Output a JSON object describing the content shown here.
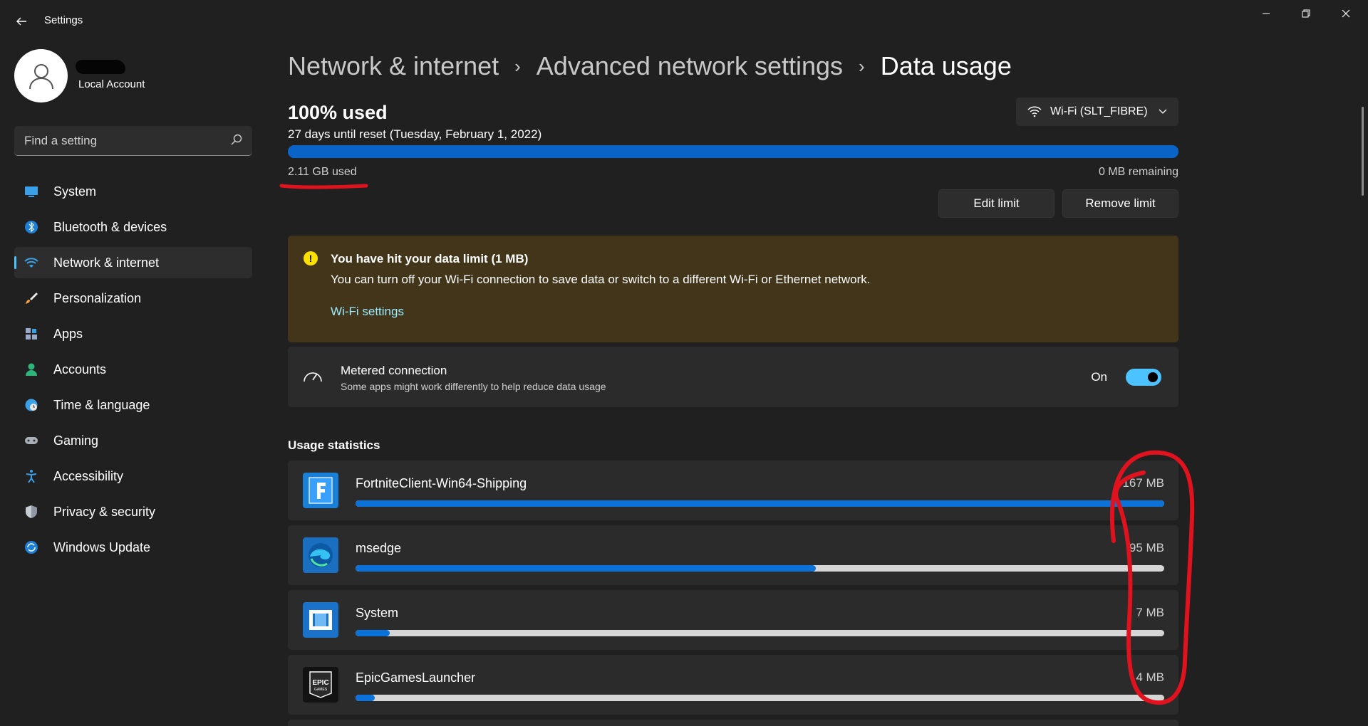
{
  "window": {
    "title": "Settings",
    "controls": [
      "minimize",
      "restore",
      "close"
    ]
  },
  "account": {
    "type": "Local Account"
  },
  "search": {
    "placeholder": "Find a setting"
  },
  "nav": {
    "items": [
      {
        "label": "System",
        "icon": "system-icon"
      },
      {
        "label": "Bluetooth & devices",
        "icon": "bluetooth-icon"
      },
      {
        "label": "Network & internet",
        "icon": "wifi-icon",
        "active": true
      },
      {
        "label": "Personalization",
        "icon": "brush-icon"
      },
      {
        "label": "Apps",
        "icon": "apps-icon"
      },
      {
        "label": "Accounts",
        "icon": "accounts-icon"
      },
      {
        "label": "Time & language",
        "icon": "globe-clock-icon"
      },
      {
        "label": "Gaming",
        "icon": "gamepad-icon"
      },
      {
        "label": "Accessibility",
        "icon": "accessibility-icon"
      },
      {
        "label": "Privacy & security",
        "icon": "shield-icon"
      },
      {
        "label": "Windows Update",
        "icon": "update-icon"
      }
    ]
  },
  "breadcrumb": {
    "level1": "Network & internet",
    "level2": "Advanced network settings",
    "current": "Data usage",
    "separator": "›"
  },
  "usage": {
    "percent_label": "100% used",
    "reset_text": "27 days until reset (Tuesday, February 1, 2022)",
    "used_text": "2.11 GB used",
    "remaining_text": "0 MB remaining",
    "used_fraction": 1.0
  },
  "network_select": {
    "value": "Wi-Fi (SLT_FIBRE)"
  },
  "buttons": {
    "edit_limit": "Edit limit",
    "remove_limit": "Remove limit"
  },
  "warning": {
    "title": "You have hit your data limit (1 MB)",
    "body": "You can turn off your Wi-Fi connection to save data or switch to a different Wi-Fi or Ethernet network.",
    "link": "Wi-Fi settings"
  },
  "metered": {
    "title": "Metered connection",
    "subtitle": "Some apps might work differently to help reduce data usage",
    "state_label": "On",
    "enabled": true
  },
  "usage_statistics": {
    "title": "Usage statistics",
    "apps": [
      {
        "name": "FortniteClient-Win64-Shipping",
        "size": "167 MB",
        "fraction": 1.0,
        "icon": "fortnite-icon"
      },
      {
        "name": "msedge",
        "size": "95 MB",
        "fraction": 0.569,
        "icon": "edge-icon"
      },
      {
        "name": "System",
        "size": "7 MB",
        "fraction": 0.042,
        "icon": "system-app-icon"
      },
      {
        "name": "EpicGamesLauncher",
        "size": "4 MB",
        "fraction": 0.024,
        "icon": "epic-games-icon"
      }
    ]
  },
  "colors": {
    "background": "#202020",
    "card": "#2b2b2b",
    "accent": "#4cc2ff",
    "progress": "#0a64c8",
    "warning_bg": "#433519",
    "annotation_red": "#e0121e"
  }
}
